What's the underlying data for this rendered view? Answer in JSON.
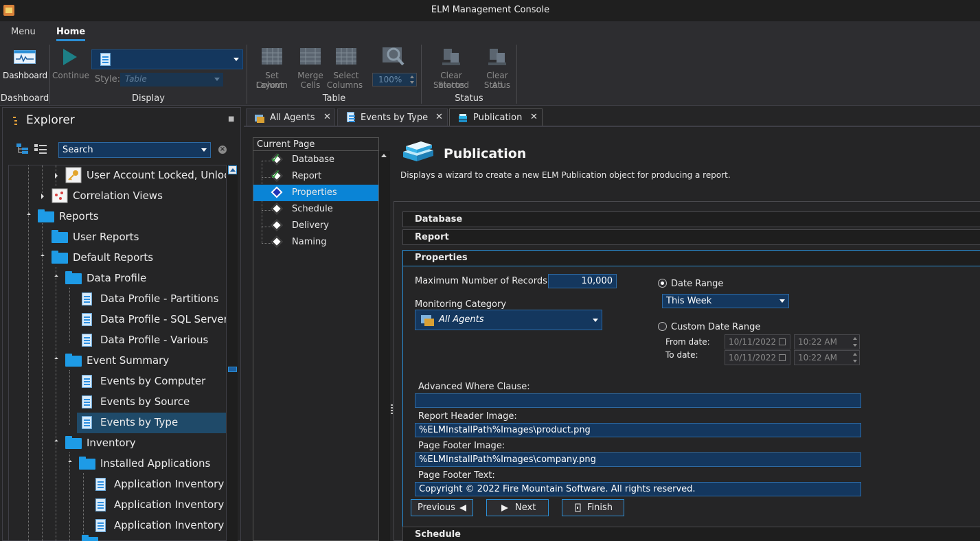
{
  "window": {
    "title": "ELM Management Console"
  },
  "ribbon": {
    "tabs": [
      "Menu",
      "Home"
    ],
    "groups": {
      "dashboard": {
        "label": "Dashboard",
        "button": "Dashboard"
      },
      "display": {
        "label": "Display",
        "continue": "Continue",
        "style_label": "Style:",
        "style_value": "Table"
      },
      "table": {
        "label": "Table",
        "set_column_layout": [
          "Set Column",
          "Layout"
        ],
        "merge_cells": [
          "Merge",
          "Cells"
        ],
        "select_columns": [
          "Select",
          "Columns"
        ],
        "zoom": "100%"
      },
      "status": {
        "label": "Status",
        "clear_selected": [
          "Clear Selected",
          "Status"
        ],
        "clear_all": [
          "Clear All",
          "Status"
        ]
      }
    }
  },
  "explorer": {
    "title": "Explorer",
    "search_value": "Search",
    "tree": [
      "User Account Locked, Unlock",
      "Correlation Views",
      "Reports",
      "User Reports",
      "Default Reports",
      "Data Profile",
      "Data Profile - Partitions",
      "Data Profile - SQL Server",
      "Data Profile - Various",
      "Event Summary",
      "Events by Computer",
      "Events by Source",
      "Events by Type",
      "Inventory",
      "Installed Applications",
      "Application Inventory b",
      "Application Inventory B",
      "Application Inventory b"
    ]
  },
  "doc_tabs": [
    "All Agents",
    "Events by Type",
    "Publication"
  ],
  "wizard_nav": {
    "header": "Current Page",
    "items": [
      "Database",
      "Report",
      "Properties",
      "Schedule",
      "Delivery",
      "Naming"
    ]
  },
  "publication": {
    "title": "Publication",
    "description": "Displays a wizard to create a new ELM Publication object for producing a report.",
    "sections": {
      "database": "Database",
      "report": "Report",
      "properties": "Properties",
      "schedule": "Schedule"
    },
    "max_records_label": "Maximum Number of Records:",
    "max_records_value": "10,000",
    "monitoring_category_label": "Monitoring Category",
    "monitoring_category_value": "All Agents",
    "date_range_label": "Date Range",
    "date_range_value": "This Week",
    "custom_date_range_label": "Custom Date Range",
    "from_date_label": "From date:",
    "to_date_label": "To date:",
    "from_date": "10/11/2022",
    "from_time": "10:22 AM",
    "to_date": "10/11/2022",
    "to_time": "10:22 AM",
    "advanced_where_label": "Advanced Where Clause:",
    "advanced_where_value": "",
    "header_image_label": "Report Header Image:",
    "header_image_value": "%ELMInstallPath%Images\\product.png",
    "footer_image_label": "Page Footer Image:",
    "footer_image_value": "%ELMInstallPath%Images\\company.png",
    "footer_text_label": "Page Footer Text:",
    "footer_text_value": "Copyright © 2022 Fire Mountain Software. All rights reserved.",
    "buttons": {
      "previous": "Previous",
      "next": "Next",
      "finish": "Finish"
    }
  },
  "colors": {
    "accent": "#2b8fd6",
    "selection": "#0a84d6",
    "input_bg": "#14375e",
    "folder": "#1e9be6"
  }
}
